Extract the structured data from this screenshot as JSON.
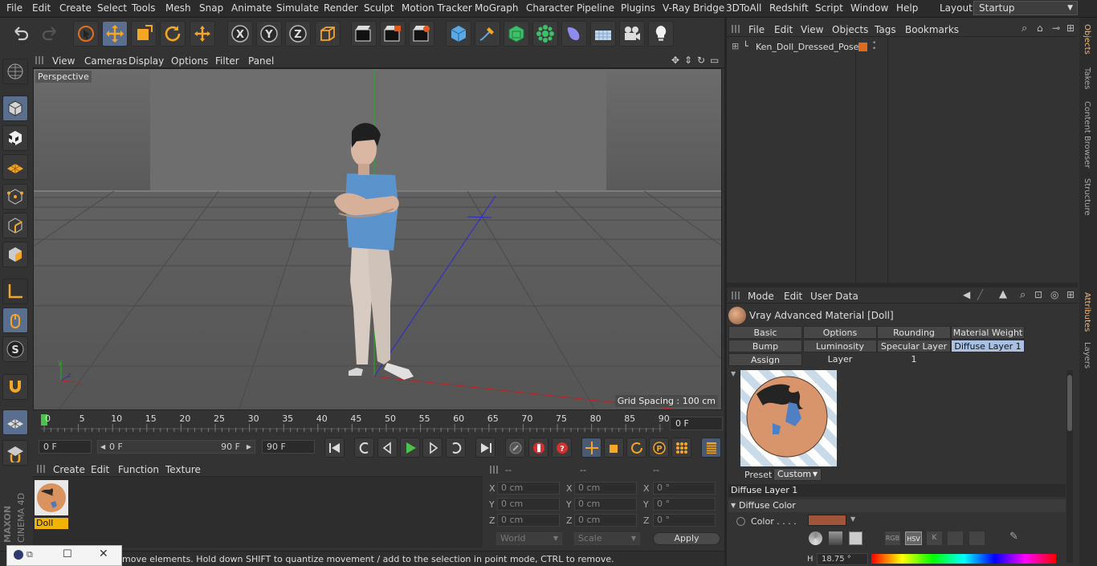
{
  "menubar": {
    "items": [
      "File",
      "Edit",
      "Create",
      "Select",
      "Tools",
      "Mesh",
      "Snap",
      "Animate",
      "Simulate",
      "Render",
      "Sculpt",
      "Motion Tracker",
      "MoGraph",
      "Character",
      "Pipeline",
      "Plugins",
      "V-Ray Bridge",
      "3DToAll",
      "Redshift",
      "Script",
      "Window",
      "Help"
    ],
    "layout_label": "Layout:",
    "layout_value": "Startup"
  },
  "toolbar": {
    "icons": [
      "undo-icon",
      "redo-icon",
      "live-selection-icon",
      "move-icon",
      "scale-icon",
      "rotate-icon",
      "recent-tool-icon",
      "x-axis-icon",
      "y-axis-icon",
      "z-axis-icon",
      "coordinate-system-icon",
      "render-view-icon",
      "render-picture-viewer-icon",
      "render-settings-icon",
      "cube-icon",
      "pen-icon",
      "subdivision-icon",
      "cloner-icon",
      "deformer-icon",
      "floor-icon",
      "camera-icon",
      "light-icon"
    ],
    "axis_labels": [
      "X",
      "Y",
      "Z"
    ]
  },
  "viewport": {
    "menu": [
      "View",
      "Cameras",
      "Display",
      "Options",
      "Filter",
      "Panel"
    ],
    "label": "Perspective",
    "grid_spacing": "Grid Spacing : 100 cm"
  },
  "timeline": {
    "ticks": [
      "0",
      "5",
      "10",
      "15",
      "20",
      "25",
      "30",
      "35",
      "40",
      "45",
      "50",
      "55",
      "60",
      "65",
      "70",
      "75",
      "80",
      "85",
      "90"
    ],
    "current_frame": "0 F"
  },
  "transport": {
    "start_field": "0 F",
    "range_min": "0 F",
    "range_max": "90 F",
    "end_field": "90 F"
  },
  "material_manager": {
    "menu": [
      "Create",
      "Edit",
      "Function",
      "Texture"
    ],
    "materials": [
      {
        "name": "Doll"
      }
    ]
  },
  "coordinates": {
    "headers": [
      "--",
      "--",
      "--"
    ],
    "rows": [
      {
        "axis": "X",
        "pos": "0 cm",
        "size_axis": "X",
        "size": "0 cm",
        "rot_axis": "X",
        "rot": "0 °"
      },
      {
        "axis": "Y",
        "pos": "0 cm",
        "size_axis": "Y",
        "size": "0 cm",
        "rot_axis": "Y",
        "rot": "0 °"
      },
      {
        "axis": "Z",
        "pos": "0 cm",
        "size_axis": "Z",
        "size": "0 cm",
        "rot_axis": "Z",
        "rot": "0 °"
      }
    ],
    "mode_world": "World",
    "mode_scale": "Scale",
    "apply_label": "Apply"
  },
  "statusbar": {
    "text": "move elements. Hold down SHIFT to quantize movement / add to the selection in point mode, CTRL to remove."
  },
  "objects": {
    "menu": [
      "File",
      "Edit",
      "View",
      "Objects",
      "Tags",
      "Bookmarks"
    ],
    "items": [
      {
        "name": "Ken_Doll_Dressed_Pose"
      }
    ]
  },
  "right_tabs": [
    "Objects",
    "Takes",
    "Content Browser",
    "Structure",
    "Attributes",
    "Layers"
  ],
  "attributes": {
    "menu": [
      "Mode",
      "Edit",
      "User Data"
    ],
    "title": "Vray Advanced Material [Doll]",
    "tabs_row1": [
      "Basic",
      "Options",
      "Rounding",
      "Material Weight"
    ],
    "tabs_row2": [
      "Bump",
      "Luminosity Layer",
      "Specular Layer 1",
      "Diffuse Layer 1"
    ],
    "tabs_row3": [
      "Assign"
    ],
    "selected_tab": "Diffuse Layer 1",
    "preset_label": "Preset",
    "preset_value": "Custom",
    "section": "Diffuse Layer 1",
    "subsection": "Diffuse Color",
    "color_label": "Color . . . .",
    "color_swatch": "#a0553a",
    "mode_buttons": [
      "RGB",
      "HSV",
      "K"
    ],
    "h_label": "H",
    "h_value": "18.75 °"
  },
  "colors": {
    "accent": "#5a6f90",
    "selected_tab": "#aac0e2",
    "material_label": "#f0b400",
    "swatch": "#a0553a"
  }
}
